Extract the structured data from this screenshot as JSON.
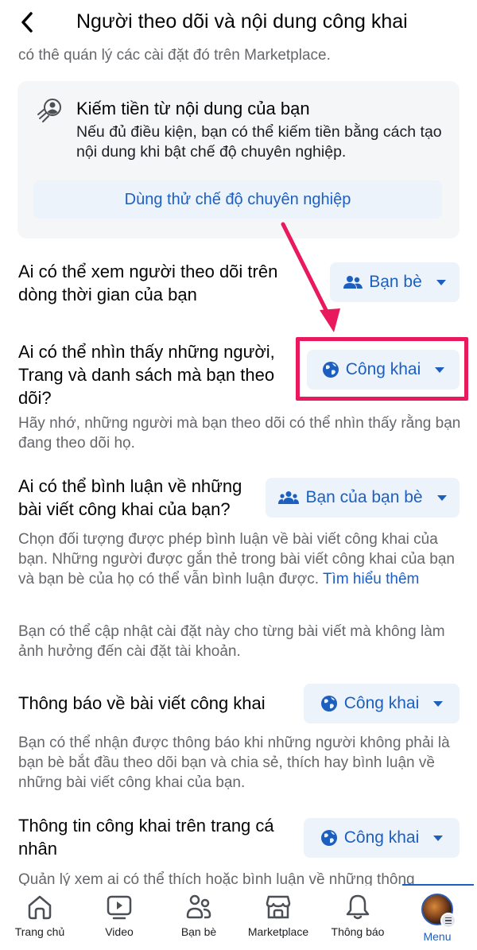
{
  "header": {
    "title": "Người theo dõi và nội dung công khai",
    "back_icon": "chevron-left-icon"
  },
  "top_text": "có thê quán lý các cài đặt đó trên Marketplace.",
  "monetize_card": {
    "icon": "professional-mode-icon",
    "title": "Kiếm tiền từ nội dung của bạn",
    "description": "Nếu đủ điều kiện, bạn có thể kiếm tiền bằng cách tạo nội dung khi bật chế độ chuyên nghiệp.",
    "button_label": "Dùng thử chế độ chuyên nghiệp"
  },
  "settings": [
    {
      "label": "Ai có thể xem người theo dõi trên dòng thời gian của bạn",
      "value": "Bạn bè",
      "icon": "friends-icon"
    },
    {
      "label": "Ai có thể nhìn thấy những người, Trang và danh sách mà bạn theo dõi?",
      "value": "Công khai",
      "icon": "globe-icon",
      "description": "Hãy nhớ, những người mà bạn theo dõi có thể nhìn thấy rằng bạn đang theo dõi họ.",
      "highlighted": true
    },
    {
      "label": "Ai có thể bình luận về những bài viết công khai của bạn?",
      "value": "Bạn của bạn bè",
      "icon": "friends-of-friends-icon",
      "description": "Chọn đối tượng được phép bình luận về bài viết công khai của bạn. Những người được gắn thẻ trong bài viết công khai của bạn và bạn bè của họ có thể vẫn bình luận được.",
      "link": "Tìm hiểu thêm",
      "note": "Bạn có thể cập nhật cài đặt này cho từng bài viết mà không làm ảnh hưởng đến cài đặt tài khoản."
    },
    {
      "label": "Thông báo về bài viết công khai",
      "value": "Công khai",
      "icon": "globe-icon",
      "description": "Bạn có thể nhận được thông báo khi những người không phải là bạn bè bắt đầu theo dõi bạn và chia sẻ, thích hay bình luận về những bài viết công khai của bạn."
    },
    {
      "label": "Thông tin công khai trên trang cá nhân",
      "value": "Công khai",
      "icon": "globe-icon",
      "description": "Quản lý xem ai có thể thích hoặc bình luận về những thông"
    }
  ],
  "tabbar": {
    "items": [
      {
        "label": "Trang chủ",
        "icon": "home-icon"
      },
      {
        "label": "Video",
        "icon": "video-icon"
      },
      {
        "label": "Bạn bè",
        "icon": "friends-icon"
      },
      {
        "label": "Marketplace",
        "icon": "marketplace-icon"
      },
      {
        "label": "Thông báo",
        "icon": "bell-icon"
      },
      {
        "label": "Menu",
        "icon": "avatar-menu-icon",
        "active": true
      }
    ]
  },
  "colors": {
    "accent": "#1d5fbf",
    "highlight": "#e8195c",
    "button_bg": "#edf3fb",
    "secondary_text": "#65676b"
  }
}
